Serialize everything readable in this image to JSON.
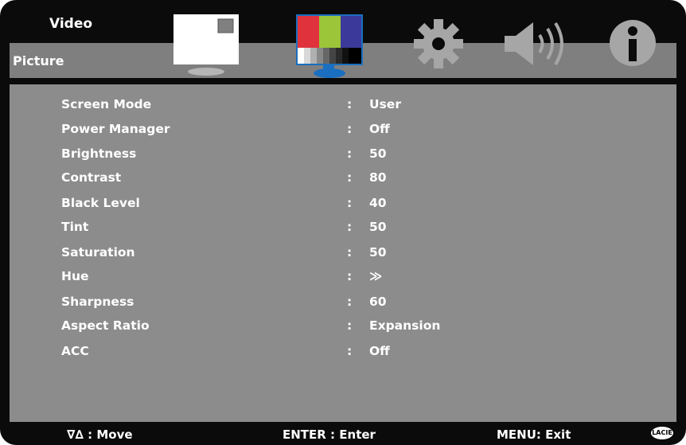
{
  "header": {
    "title": "Video"
  },
  "section": {
    "title": "Picture"
  },
  "tabs": [
    {
      "name": "picture-tab",
      "icon": "monitor-white-icon",
      "selected": false
    },
    {
      "name": "color-tab",
      "icon": "color-bars-monitor-icon",
      "selected": true
    },
    {
      "name": "setup-tab",
      "icon": "gear-icon",
      "selected": false
    },
    {
      "name": "audio-tab",
      "icon": "speaker-icon",
      "selected": false
    },
    {
      "name": "info-tab",
      "icon": "info-icon",
      "selected": false
    }
  ],
  "settings": [
    {
      "label": "Screen Mode",
      "value": "User"
    },
    {
      "label": "Power Manager",
      "value": "Off"
    },
    {
      "label": "Brightness",
      "value": "50"
    },
    {
      "label": "Contrast",
      "value": "80"
    },
    {
      "label": "Black Level",
      "value": "40"
    },
    {
      "label": "Tint",
      "value": "50"
    },
    {
      "label": "Saturation",
      "value": "50"
    },
    {
      "label": "Hue",
      "value": "≫"
    },
    {
      "label": "Sharpness",
      "value": "60"
    },
    {
      "label": "Aspect Ratio",
      "value": "Expansion"
    },
    {
      "label": "ACC",
      "value": "Off"
    }
  ],
  "separator": ":",
  "footer": {
    "move": "∇∆  : Move",
    "enter": "ENTER : Enter",
    "exit": "MENU: Exit"
  },
  "logo": {
    "text": "LACIE"
  },
  "colors": {
    "background": "#0b0b0b",
    "band": "#7f7f7f",
    "panel": "#8c8c8c",
    "selected_border": "#1a6fc0",
    "text": "#ffffff"
  }
}
